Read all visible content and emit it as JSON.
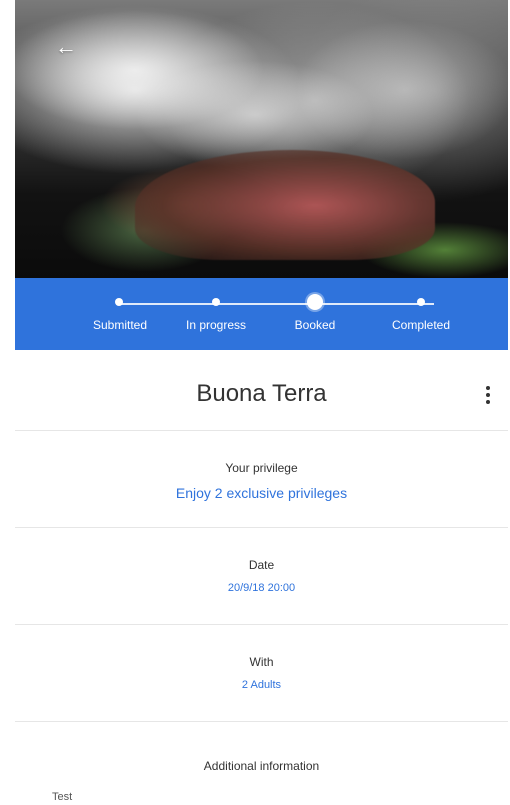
{
  "header": {
    "back_icon": "arrow-left-icon"
  },
  "status": {
    "steps": [
      {
        "label": "Submitted",
        "active": false
      },
      {
        "label": "In progress",
        "active": false
      },
      {
        "label": "Booked",
        "active": true
      },
      {
        "label": "Completed",
        "active": false
      }
    ]
  },
  "restaurant": {
    "name": "Buona Terra",
    "menu_icon": "more-vertical-icon"
  },
  "privilege": {
    "label": "Your privilege",
    "value": "Enjoy 2 exclusive privileges"
  },
  "date": {
    "label": "Date",
    "value": "20/9/18 20:00"
  },
  "with": {
    "label": "With",
    "value": "2 Adults"
  },
  "additional": {
    "label": "Additional information",
    "text": "Test"
  },
  "colors": {
    "accent": "#2f73dc"
  }
}
